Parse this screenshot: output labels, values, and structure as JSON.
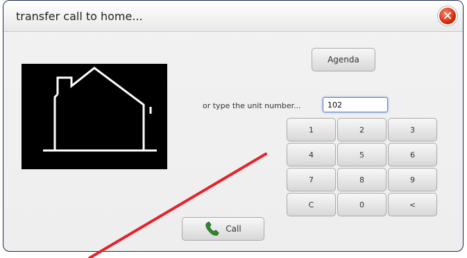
{
  "dialog": {
    "title": "transfer call to home...",
    "close_icon": "close-icon"
  },
  "agenda_label": "Agenda",
  "unit_prompt": "or type the unit number...",
  "unit_value": "102",
  "keypad": [
    "1",
    "2",
    "3",
    "4",
    "5",
    "6",
    "7",
    "8",
    "9",
    "C",
    "0",
    "<"
  ],
  "call_label": "Call",
  "colors": {
    "close": "#d42a0e",
    "annotation_line": "#e8202a",
    "phone_icon": "#2f8a2f"
  }
}
